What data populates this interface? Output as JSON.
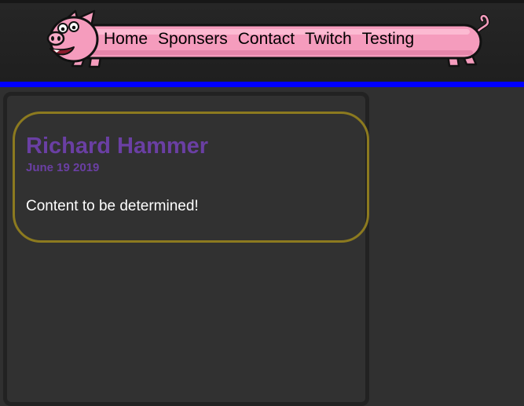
{
  "nav": {
    "items": [
      {
        "label": "Home"
      },
      {
        "label": "Sponsers"
      },
      {
        "label": "Contact"
      },
      {
        "label": "Twitch"
      },
      {
        "label": "Testing"
      }
    ]
  },
  "post": {
    "title": "Richard Hammer",
    "date": "June 19 2019",
    "body": "Content to be determined!"
  },
  "colors": {
    "header_rule": "#0000ff",
    "title_purple": "#6a3fa3",
    "post_border_gold": "#8c7a1f",
    "pig_pink": "#f59cbd",
    "page_background": "#303030"
  },
  "icons": {
    "logo": "pig-banner-icon"
  }
}
